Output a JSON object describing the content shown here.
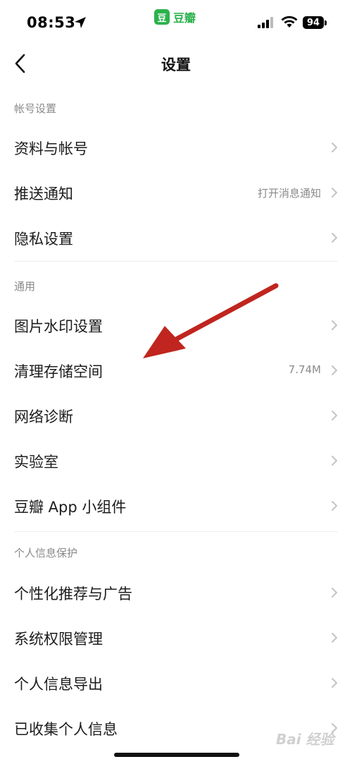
{
  "status_bar": {
    "time": "08:53",
    "app_name": "豆瓣",
    "app_logo_char": "豆",
    "battery": "94",
    "icons": [
      "location-arrow-icon",
      "signal-icon",
      "wifi-icon",
      "battery-icon"
    ]
  },
  "nav": {
    "title": "设置",
    "back_icon": "chevron-left-icon"
  },
  "sections": [
    {
      "header": "帐号设置",
      "items": [
        {
          "label": "资料与帐号",
          "value": ""
        },
        {
          "label": "推送通知",
          "value": "打开消息通知"
        },
        {
          "label": "隐私设置",
          "value": ""
        }
      ]
    },
    {
      "header": "通用",
      "items": [
        {
          "label": "图片水印设置",
          "value": ""
        },
        {
          "label": "清理存储空间",
          "value": "7.74M"
        },
        {
          "label": "网络诊断",
          "value": ""
        },
        {
          "label": "实验室",
          "value": ""
        },
        {
          "label": "豆瓣 App 小组件",
          "value": ""
        }
      ]
    },
    {
      "header": "个人信息保护",
      "items": [
        {
          "label": "个性化推荐与广告",
          "value": ""
        },
        {
          "label": "系统权限管理",
          "value": ""
        },
        {
          "label": "个人信息导出",
          "value": ""
        },
        {
          "label": "已收集个人信息",
          "value": ""
        }
      ]
    }
  ],
  "annotation": {
    "type": "arrow",
    "color": "#c0251f",
    "points_to": "清理存储空间"
  },
  "watermark": "Bai 经验",
  "colors": {
    "brand": "#2bb24c",
    "secondary_text": "#8a8a8a",
    "divider": "#eeeeee"
  }
}
